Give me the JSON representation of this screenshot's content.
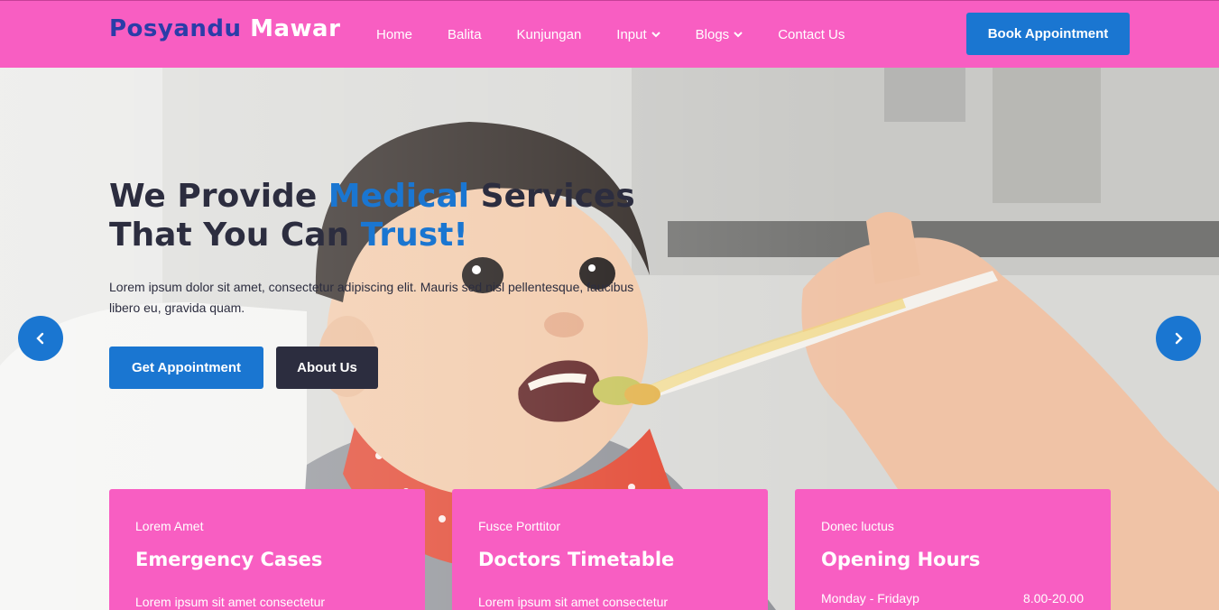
{
  "brand": {
    "part1": "Posyandu",
    "part2": "Mawar"
  },
  "nav": {
    "items": [
      {
        "label": "Home",
        "dropdown": false
      },
      {
        "label": "Balita",
        "dropdown": false
      },
      {
        "label": "Kunjungan",
        "dropdown": false
      },
      {
        "label": "Input",
        "dropdown": true
      },
      {
        "label": "Blogs",
        "dropdown": true
      },
      {
        "label": "Contact Us",
        "dropdown": false
      }
    ],
    "cta": "Book Appointment"
  },
  "hero": {
    "headline_a": "We Provide ",
    "headline_b": "Medical",
    "headline_c": " Services",
    "headline_d": "That You Can ",
    "headline_e": "Trust!",
    "description": "Lorem ipsum dolor sit amet, consectetur adipiscing elit. Mauris sed nisl pellentesque, faucibus libero eu, gravida quam.",
    "primary_button": "Get Appointment",
    "secondary_button": "About Us"
  },
  "cards": [
    {
      "subtitle": "Lorem Amet",
      "title": "Emergency Cases",
      "text": "Lorem ipsum sit amet consectetur"
    },
    {
      "subtitle": "Fusce Porttitor",
      "title": "Doctors Timetable",
      "text": "Lorem ipsum sit amet consectetur"
    },
    {
      "subtitle": "Donec luctus",
      "title": "Opening Hours",
      "hours_day": "Monday - Fridayp",
      "hours_time": "8.00-20.00"
    }
  ],
  "colors": {
    "header_bg": "#f85ec2",
    "accent_blue": "#1a76d1",
    "dark": "#2c2d3f",
    "logo_blue": "#2a3da8"
  },
  "icons": [
    "chevron-down-icon",
    "chevron-left-icon",
    "chevron-right-icon"
  ]
}
